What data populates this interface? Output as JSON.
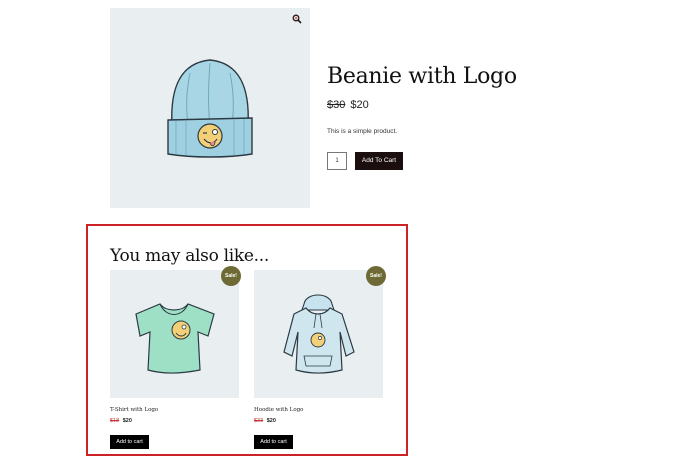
{
  "product": {
    "title": "Beanie with Logo",
    "old_price": "$30",
    "new_price": "$20",
    "description": "This is a simple product.",
    "quantity": "1",
    "add_to_cart_label": "Add To Cart"
  },
  "related": {
    "heading": "You may also like...",
    "items": [
      {
        "name": "T-Shirt with Logo",
        "old_price": "$18",
        "new_price": "$20",
        "badge": "Sale!",
        "button_label": "Add to cart",
        "image_icon": "tshirt-icon"
      },
      {
        "name": "Hoodie with Logo",
        "old_price": "$33",
        "new_price": "$20",
        "badge": "Sale!",
        "button_label": "Add to cart",
        "image_icon": "hoodie-icon"
      }
    ]
  },
  "colors": {
    "image_background": "#e9eef1",
    "button_background": "#1a0e0e",
    "sale_badge": "#6e6a35",
    "highlight_border": "#cc2127"
  },
  "icons": {
    "zoom": "zoom-magnifier-icon",
    "main_image": "beanie-icon"
  }
}
